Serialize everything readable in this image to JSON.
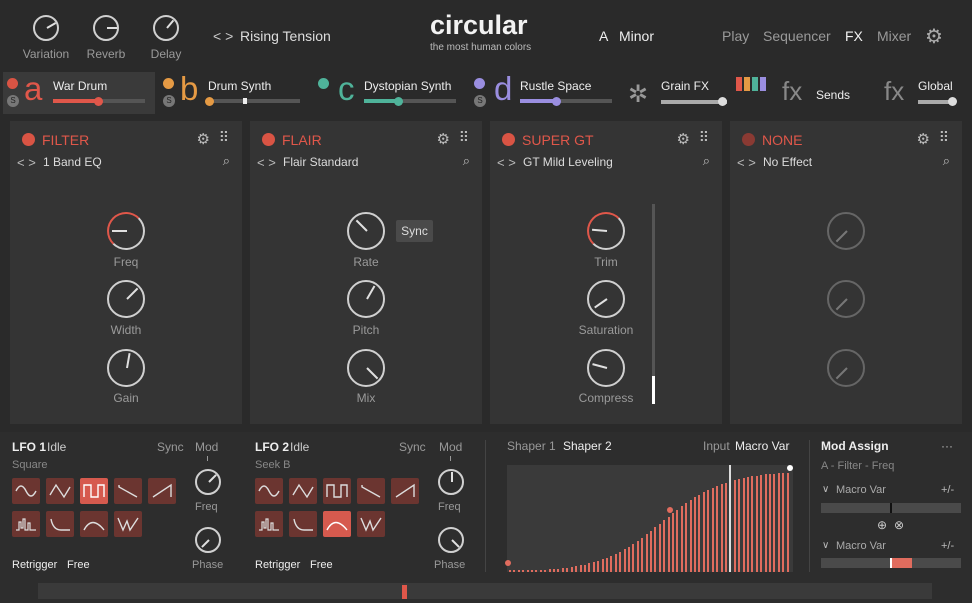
{
  "top": {
    "knobs": [
      {
        "label": "Variation"
      },
      {
        "label": "Reverb"
      },
      {
        "label": "Delay"
      }
    ],
    "nav_arrows": "< >",
    "preset_name": "Rising Tension",
    "logo_text": "circular",
    "logo_tagline": "the most human colors",
    "key": "A",
    "scale": "Minor",
    "menu": [
      "Play",
      "Sequencer",
      "FX",
      "Mixer"
    ],
    "active_menu": "FX"
  },
  "slots": [
    {
      "letter": "a",
      "name": "War Drum",
      "solo": "S",
      "color": "#e0574a",
      "level": 0.62
    },
    {
      "letter": "b",
      "name": "Drum Synth",
      "solo": "S",
      "color": "#e59a44",
      "level": 0.05
    },
    {
      "letter": "c",
      "name": "Dystopian Synth",
      "solo": "",
      "color": "#4fb39a",
      "level": 0.32
    },
    {
      "letter": "d",
      "name": "Rustle Space",
      "solo": "S",
      "color": "#9a8ee0",
      "level": 0.38
    }
  ],
  "fx_slots": [
    {
      "name": "Grain FX",
      "level": 0.66
    },
    {
      "name": "Sends",
      "prefix": "fx"
    },
    {
      "name": "Global",
      "prefix": "fx",
      "level": 1.0
    }
  ],
  "panels": [
    {
      "title": "FILTER",
      "preset": "1 Band EQ",
      "knobs": [
        "Freq",
        "Width",
        "Gain"
      ]
    },
    {
      "title": "FLAIR",
      "preset": "Flair Standard",
      "knobs": [
        "Rate",
        "Pitch",
        "Mix"
      ],
      "sync_label": "Sync"
    },
    {
      "title": "SUPER GT",
      "preset": "GT Mild Leveling",
      "knobs": [
        "Trim",
        "Saturation",
        "Compress"
      ]
    },
    {
      "title": "NONE",
      "preset": "No Effect",
      "knobs": [
        "",
        "",
        ""
      ]
    }
  ],
  "lfo1": {
    "title": "LFO 1",
    "state": "Idle",
    "sync": "Sync",
    "wave_name": "Square",
    "mod": "Mod",
    "freq": "Freq",
    "phase": "Phase",
    "retrigger": "Retrigger",
    "retrigger_value": "Free"
  },
  "lfo2": {
    "title": "LFO 2",
    "state": "Idle",
    "sync": "Sync",
    "wave_name": "Seek B",
    "mod": "Mod",
    "freq": "Freq",
    "phase": "Phase",
    "retrigger": "Retrigger",
    "retrigger_value": "Free"
  },
  "shaper": {
    "tabs": [
      "Shaper 1",
      "Shaper 2"
    ],
    "active": "Shaper 2",
    "input_label": "Input",
    "input_value": "Macro Var"
  },
  "mod_assign": {
    "title": "Mod Assign",
    "more": "···",
    "target": "A - Filter - Freq",
    "rows": [
      {
        "label": "Macro Var",
        "pm": "+/-"
      },
      {
        "label": "Macro Var",
        "pm": "+/-"
      }
    ]
  }
}
